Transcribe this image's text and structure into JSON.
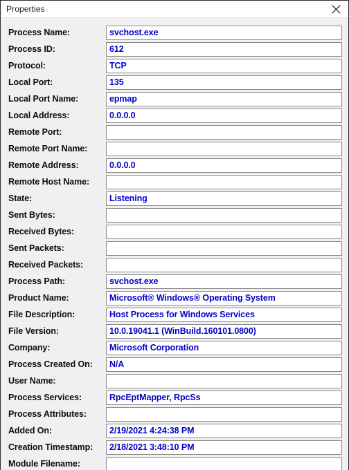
{
  "window": {
    "title": "Properties",
    "close_icon": "close-icon",
    "accent_value_color": "#0000c8",
    "label_color": "#0d0d0d",
    "background_color": "#f0f0f0",
    "field_background_color": "#ffffff",
    "field_border_color": "#8a8a8a",
    "titlebar_color": "#ffffff"
  },
  "rows": [
    {
      "label": "Process Name:",
      "value": "svchost.exe"
    },
    {
      "label": "Process ID:",
      "value": "612"
    },
    {
      "label": "Protocol:",
      "value": "TCP"
    },
    {
      "label": "Local Port:",
      "value": "135"
    },
    {
      "label": "Local Port Name:",
      "value": "epmap"
    },
    {
      "label": "Local Address:",
      "value": "0.0.0.0"
    },
    {
      "label": "Remote Port:",
      "value": ""
    },
    {
      "label": "Remote Port Name:",
      "value": ""
    },
    {
      "label": "Remote Address:",
      "value": "0.0.0.0"
    },
    {
      "label": "Remote Host Name:",
      "value": ""
    },
    {
      "label": "State:",
      "value": "Listening"
    },
    {
      "label": "Sent Bytes:",
      "value": ""
    },
    {
      "label": "Received Bytes:",
      "value": ""
    },
    {
      "label": "Sent Packets:",
      "value": ""
    },
    {
      "label": "Received Packets:",
      "value": ""
    },
    {
      "label": "Process Path:",
      "value": "svchost.exe"
    },
    {
      "label": "Product Name:",
      "value": "Microsoft® Windows® Operating System"
    },
    {
      "label": "File Description:",
      "value": "Host Process for Windows Services"
    },
    {
      "label": "File Version:",
      "value": "10.0.19041.1 (WinBuild.160101.0800)"
    },
    {
      "label": "Company:",
      "value": "Microsoft Corporation"
    },
    {
      "label": "Process Created On:",
      "value": "N/A"
    },
    {
      "label": "User Name:",
      "value": ""
    },
    {
      "label": "Process Services:",
      "value": "RpcEptMapper, RpcSs"
    },
    {
      "label": "Process Attributes:",
      "value": ""
    },
    {
      "label": "Added On:",
      "value": "2/19/2021 4:24:38 PM"
    },
    {
      "label": "Creation Timestamp:",
      "value": "2/18/2021 3:48:10 PM"
    },
    {
      "label": "Module Filename:",
      "value": ""
    }
  ]
}
